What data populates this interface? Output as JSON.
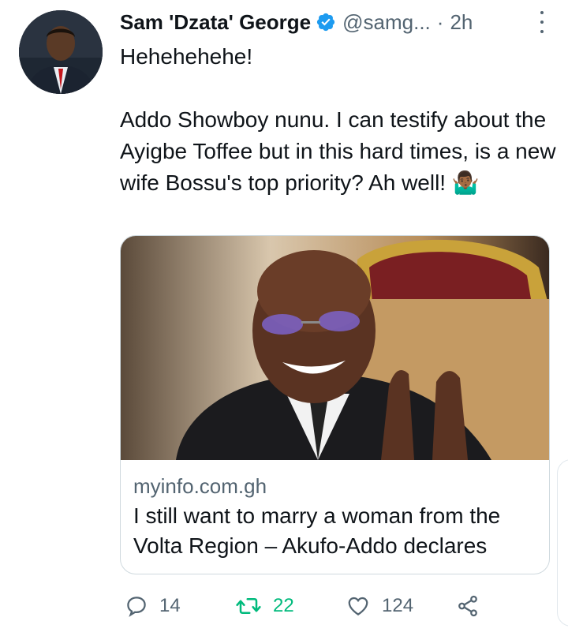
{
  "tweet": {
    "author_name": "Sam 'Dzata' George",
    "handle": "@samg...",
    "separator": "·",
    "time": "2h",
    "text": "Hehehehehe!\n\nAddo Showboy nunu. I can testify about the Ayigbe Toffee but in this hard times, is a new wife Bossu's top priority? Ah well! 🤷🏾‍♂️",
    "emoji_icon": "person-shrugging-icon"
  },
  "card": {
    "domain": "myinfo.com.gh",
    "title": "I still want to marry a woman from the Volta Region – Akufo-Addo declares"
  },
  "actions": {
    "replies": "14",
    "retweets": "22",
    "likes": "124"
  },
  "colors": {
    "text": "#0f1419",
    "secondary": "#536471",
    "verified": "#1d9bf0",
    "retweet": "#00ba7c",
    "border": "#cfd9de"
  }
}
